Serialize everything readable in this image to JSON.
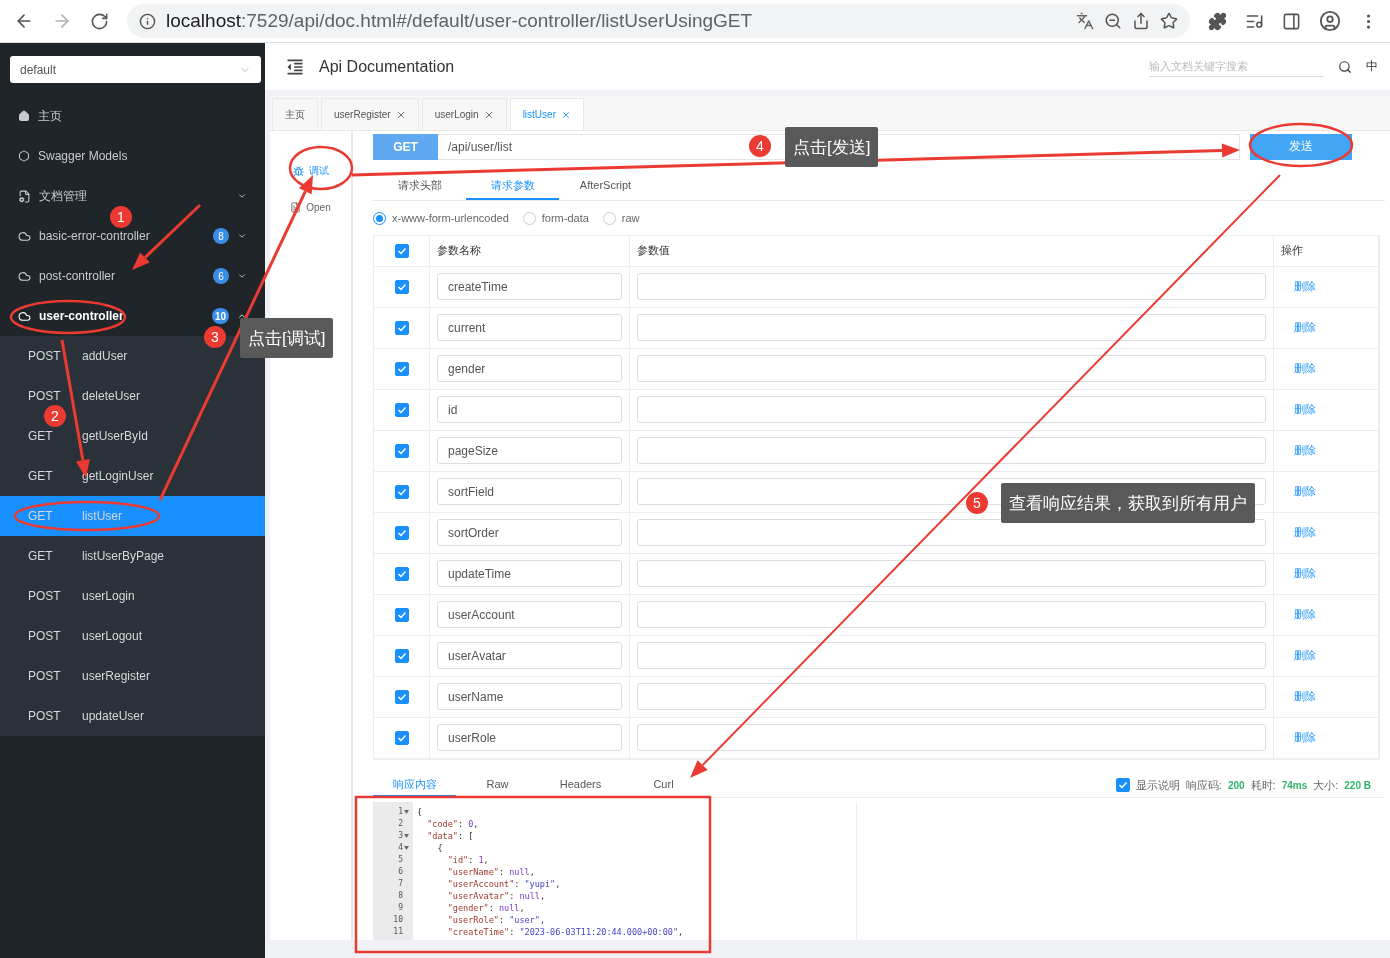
{
  "browser": {
    "url_host": "localhost",
    "url_rest": ":7529/api/doc.html#/default/user-controller/listUserUsingGET"
  },
  "sidebar": {
    "group_select": "default",
    "items": [
      {
        "kind": "home",
        "label": "主页"
      },
      {
        "kind": "models",
        "label": "Swagger Models"
      },
      {
        "kind": "folder",
        "label": "文档管理",
        "expanded": false
      },
      {
        "kind": "controller",
        "label": "basic-error-controller",
        "badge": "8",
        "expanded": false
      },
      {
        "kind": "controller",
        "label": "post-controller",
        "badge": "6",
        "expanded": false
      },
      {
        "kind": "controller",
        "label": "user-controller",
        "badge": "10",
        "expanded": true
      }
    ],
    "operations": [
      {
        "method": "POST",
        "name": "addUser",
        "selected": false
      },
      {
        "method": "POST",
        "name": "deleteUser",
        "selected": false
      },
      {
        "method": "GET",
        "name": "getUserById",
        "selected": false
      },
      {
        "method": "GET",
        "name": "getLoginUser",
        "selected": false
      },
      {
        "method": "GET",
        "name": "listUser",
        "selected": true
      },
      {
        "method": "GET",
        "name": "listUserByPage",
        "selected": false
      },
      {
        "method": "POST",
        "name": "userLogin",
        "selected": false
      },
      {
        "method": "POST",
        "name": "userLogout",
        "selected": false
      },
      {
        "method": "POST",
        "name": "userRegister",
        "selected": false
      },
      {
        "method": "POST",
        "name": "updateUser",
        "selected": false
      }
    ]
  },
  "header": {
    "title": "Api Documentation",
    "search_placeholder": "输入文档关键字搜索",
    "language": "中"
  },
  "tabs": [
    {
      "label": "主页",
      "closable": false,
      "selected": false
    },
    {
      "label": "userRegister",
      "closable": true,
      "selected": false
    },
    {
      "label": "userLogin",
      "closable": true,
      "selected": false
    },
    {
      "label": "listUser",
      "closable": true,
      "selected": true
    }
  ],
  "side_actions": [
    {
      "kind": "debug",
      "label": "调试",
      "selected": true
    },
    {
      "kind": "open",
      "label": "Open",
      "selected": false
    }
  ],
  "request": {
    "method": "GET",
    "path": "/api/user/list",
    "send": "发送"
  },
  "request_tabs": [
    {
      "label": "请求头部",
      "selected": false
    },
    {
      "label": "请求参数",
      "selected": true
    },
    {
      "label": "AfterScript",
      "selected": false
    }
  ],
  "content_types": [
    {
      "label": "x-www-form-urlencoded",
      "selected": true
    },
    {
      "label": "form-data",
      "selected": false
    },
    {
      "label": "raw",
      "selected": false
    }
  ],
  "params": {
    "all_checked": true,
    "columns": [
      "参数名称",
      "参数值",
      "操作"
    ],
    "rows": [
      {
        "name": "createTime",
        "checked": true,
        "action": "删除"
      },
      {
        "name": "current",
        "checked": true,
        "action": "删除"
      },
      {
        "name": "gender",
        "checked": true,
        "action": "删除"
      },
      {
        "name": "id",
        "checked": true,
        "action": "删除"
      },
      {
        "name": "pageSize",
        "checked": true,
        "action": "删除"
      },
      {
        "name": "sortField",
        "checked": true,
        "action": "删除"
      },
      {
        "name": "sortOrder",
        "checked": true,
        "action": "删除"
      },
      {
        "name": "updateTime",
        "checked": true,
        "action": "删除"
      },
      {
        "name": "userAccount",
        "checked": true,
        "action": "删除"
      },
      {
        "name": "userAvatar",
        "checked": true,
        "action": "删除"
      },
      {
        "name": "userName",
        "checked": true,
        "action": "删除"
      },
      {
        "name": "userRole",
        "checked": true,
        "action": "删除"
      }
    ]
  },
  "response": {
    "tabs": [
      {
        "label": "响应内容",
        "selected": true
      },
      {
        "label": "Raw",
        "selected": false
      },
      {
        "label": "Headers",
        "selected": false
      },
      {
        "label": "Curl",
        "selected": false
      }
    ],
    "show_description": {
      "label": "显示说明",
      "checked": true
    },
    "stats": [
      {
        "label": "响应码:",
        "value": "200"
      },
      {
        "label": "耗时:",
        "value": "74ms"
      },
      {
        "label": "大小:",
        "value": "220 B"
      }
    ],
    "code_lines": [
      {
        "number": "1",
        "foldable": true,
        "text": "{"
      },
      {
        "number": "2",
        "foldable": false,
        "text": "  \"code\": 0,"
      },
      {
        "number": "3",
        "foldable": true,
        "text": "  \"data\": ["
      },
      {
        "number": "4",
        "foldable": true,
        "text": "    {"
      },
      {
        "number": "5",
        "foldable": false,
        "text": "      \"id\": 1,"
      },
      {
        "number": "6",
        "foldable": false,
        "text": "      \"userName\": null,"
      },
      {
        "number": "7",
        "foldable": false,
        "text": "      \"userAccount\": \"yupi\","
      },
      {
        "number": "8",
        "foldable": false,
        "text": "      \"userAvatar\": null,"
      },
      {
        "number": "9",
        "foldable": false,
        "text": "      \"gender\": null,"
      },
      {
        "number": "10",
        "foldable": false,
        "text": "      \"userRole\": \"user\","
      },
      {
        "number": "11",
        "foldable": false,
        "text": "      \"createTime\": \"2023-06-03T11:20:44.000+00:00\","
      }
    ]
  },
  "annotations": [
    {
      "number": "1"
    },
    {
      "number": "2"
    },
    {
      "number": "3",
      "callout": "点击[调试]"
    },
    {
      "number": "4",
      "callout": "点击[发送]"
    },
    {
      "number": "5",
      "callout": "查看响应结果，获取到所有用户"
    }
  ]
}
